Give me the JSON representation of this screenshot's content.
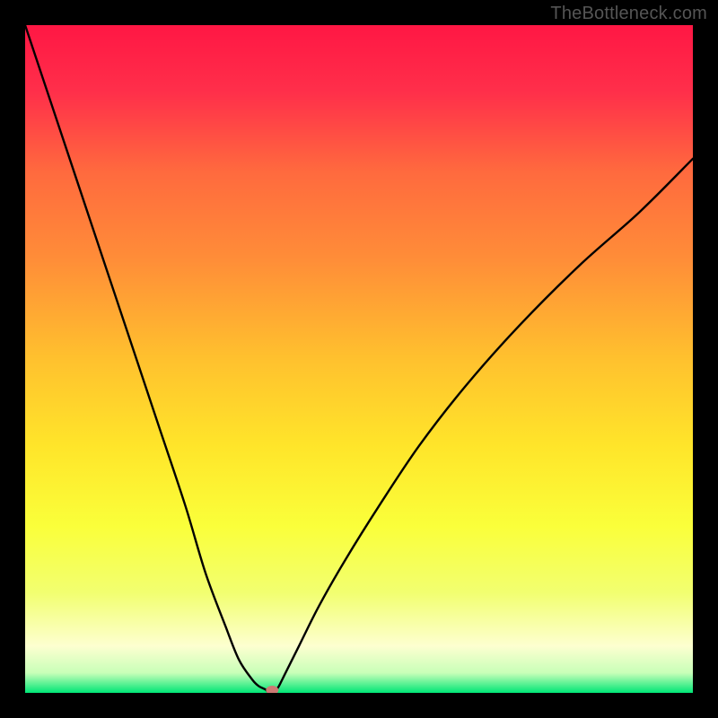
{
  "watermark": "TheBottleneck.com",
  "chart_data": {
    "type": "line",
    "title": "",
    "xlabel": "",
    "ylabel": "",
    "xlim": [
      0,
      100
    ],
    "ylim": [
      0,
      100
    ],
    "gradient_stops": [
      {
        "offset": 0.0,
        "color": "#ff1744"
      },
      {
        "offset": 0.1,
        "color": "#ff2f4a"
      },
      {
        "offset": 0.22,
        "color": "#ff6a3e"
      },
      {
        "offset": 0.35,
        "color": "#ff8d38"
      },
      {
        "offset": 0.5,
        "color": "#ffc12e"
      },
      {
        "offset": 0.63,
        "color": "#ffe52a"
      },
      {
        "offset": 0.75,
        "color": "#faff3a"
      },
      {
        "offset": 0.85,
        "color": "#f2ff70"
      },
      {
        "offset": 0.93,
        "color": "#fdffd0"
      },
      {
        "offset": 0.97,
        "color": "#c8ffb8"
      },
      {
        "offset": 1.0,
        "color": "#00e676"
      }
    ],
    "series": [
      {
        "name": "bottleneck-curve",
        "x": [
          0,
          4,
          8,
          12,
          16,
          20,
          24,
          27,
          30,
          32,
          34,
          35,
          36,
          36.5,
          37,
          37.5,
          38,
          39,
          41,
          44,
          48,
          53,
          59,
          66,
          74,
          83,
          92,
          100
        ],
        "y": [
          100,
          88,
          76,
          64,
          52,
          40,
          28,
          18,
          10,
          5,
          2,
          1,
          0.5,
          0,
          0,
          0.3,
          1,
          3,
          7,
          13,
          20,
          28,
          37,
          46,
          55,
          64,
          72,
          80
        ]
      }
    ],
    "marker": {
      "x": 37,
      "y": 0.4,
      "color": "#cd7a74",
      "rx": 7,
      "ry": 5
    }
  }
}
